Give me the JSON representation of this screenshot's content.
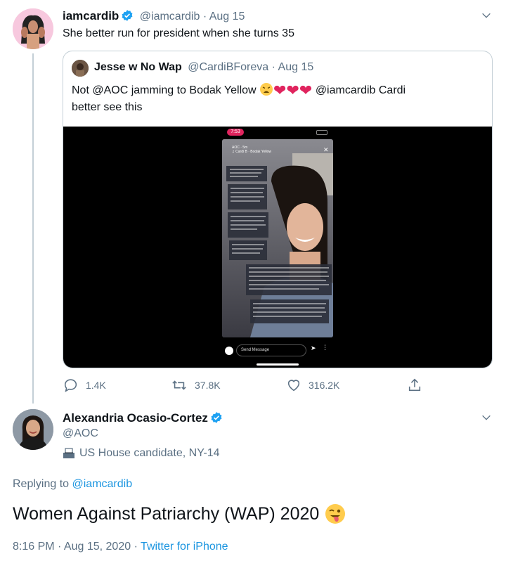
{
  "tweet": {
    "author_name": "iamcardib",
    "author_handle": "@iamcardib",
    "date": "Aug 15",
    "text": "She better run for president when she turns 35"
  },
  "quoted_tweet": {
    "author_name": "Jesse w No Wap",
    "author_handle": "@CardiBForeva",
    "date": "Aug 15",
    "text_part1": "Not @AOC jamming to Bodak Yellow",
    "text_mention": "@iamcardib",
    "text_part2": "Cardi",
    "text_line2": "better see this",
    "video": {
      "status_time": "7:53",
      "story_name": "AOC · 5m",
      "story_song": "♫ Cardi B · Bodak Yellow",
      "send_message": "Send Message"
    }
  },
  "actions": {
    "replies": "1.4K",
    "retweets": "37.8K",
    "likes": "316.2K"
  },
  "reply": {
    "author_name": "Alexandria Ocasio-Cortez",
    "author_handle": "@AOC",
    "label": "US House candidate, NY-14",
    "replying_prefix": "Replying to",
    "replying_to": "@iamcardib",
    "text": "Women Against Patriarchy (WAP) 2020",
    "time": "8:16 PM · Aug 15, 2020 ·",
    "source": "Twitter for iPhone"
  },
  "colors": {
    "link": "#1b95e0",
    "muted": "#5b7083",
    "verified": "#1da1f2",
    "heart": "#e0245e",
    "border": "#c4cfd6"
  }
}
